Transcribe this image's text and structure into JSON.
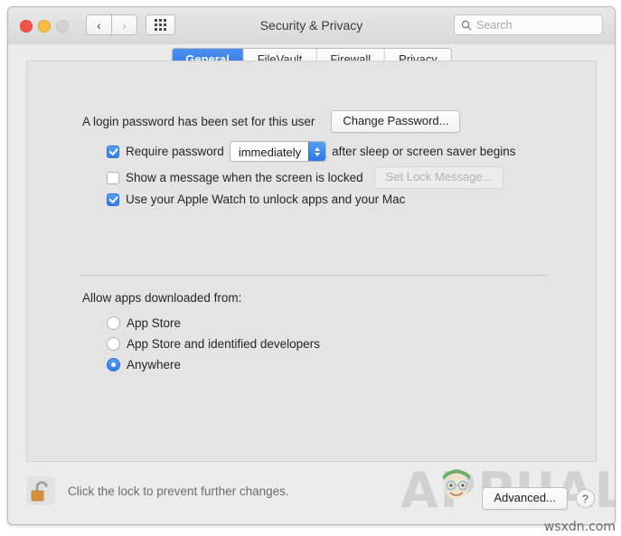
{
  "window": {
    "title": "Security & Privacy",
    "traffic_lights": [
      "close",
      "minimize",
      "zoom"
    ],
    "nav": {
      "back": "‹",
      "forward": "›",
      "grid_icon": "grid-icon"
    },
    "search": {
      "placeholder": "Search",
      "value": "",
      "icon": "search-icon"
    }
  },
  "tabs": [
    {
      "label": "General",
      "active": true
    },
    {
      "label": "FileVault",
      "active": false
    },
    {
      "label": "Firewall",
      "active": false
    },
    {
      "label": "Privacy",
      "active": false
    }
  ],
  "general": {
    "login_password_text": "A login password has been set for this user",
    "change_password_button": "Change Password...",
    "require_password": {
      "label_before": "Require password",
      "selected_delay": "immediately",
      "label_after": "after sleep or screen saver begins",
      "checked": true
    },
    "lock_message": {
      "label": "Show a message when the screen is locked",
      "checked": false,
      "button": "Set Lock Message...",
      "button_disabled": true
    },
    "apple_watch": {
      "label": "Use your Apple Watch to unlock apps and your Mac",
      "checked": true
    },
    "allow_apps": {
      "title": "Allow apps downloaded from:",
      "options": [
        {
          "label": "App Store",
          "selected": false
        },
        {
          "label": "App Store and identified developers",
          "selected": false
        },
        {
          "label": "Anywhere",
          "selected": true
        }
      ]
    }
  },
  "footer": {
    "lock_icon": "unlocked-padlock-icon",
    "lock_note": "Click the lock to prevent further changes.",
    "advanced_button": "Advanced...",
    "help_button": "?"
  },
  "watermarks": {
    "brand": "APPUALS",
    "site": "wsxdn.com"
  },
  "colors": {
    "accent_blue": "#2f7ced",
    "window_bg": "#ececec",
    "panel_bg": "#e4e4e4",
    "lock_orange": "#e59a45"
  }
}
